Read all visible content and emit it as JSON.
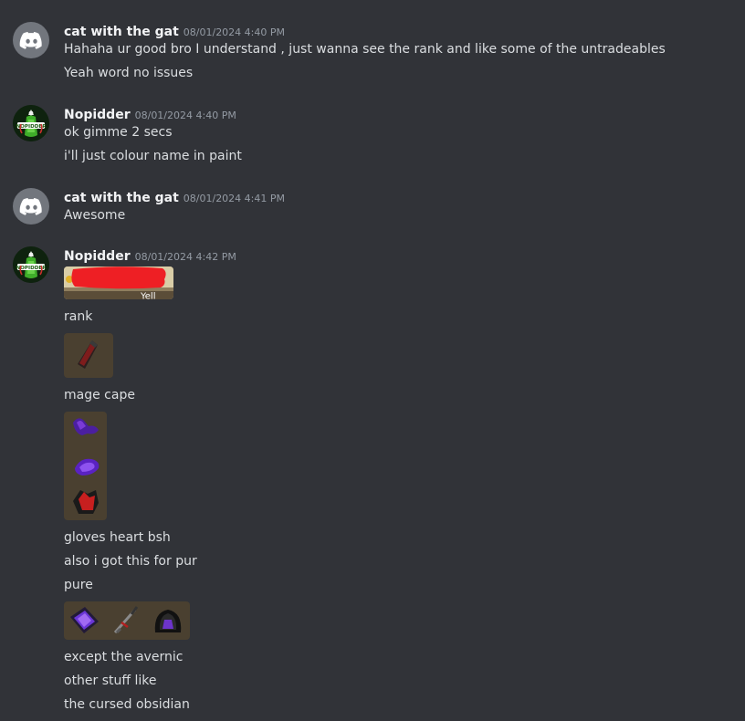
{
  "messages": [
    {
      "username": "cat with the gat",
      "timestamp": "08/01/2024 4:40 PM",
      "lines": [
        "Hahaha ur good bro I understand , just wanna see the rank and like some of the untradeables",
        "Yeah word no issues"
      ]
    },
    {
      "username": "Nopidder",
      "timestamp": "08/01/2024 4:40 PM",
      "avatar_text": "NOPIDDER",
      "lines": [
        "ok gimme 2 secs",
        "i'll just colour name in paint"
      ]
    },
    {
      "username": "cat with the gat",
      "timestamp": "08/01/2024 4:41 PM",
      "lines": [
        "Awesome"
      ]
    },
    {
      "username": "Nopidder",
      "timestamp": "08/01/2024 4:42 PM",
      "avatar_text": "NOPIDDER",
      "rank_image_text": "Yell",
      "lines": [
        "rank",
        "mage cape",
        "gloves heart bsh",
        "also i got this for pur",
        "pure",
        "except the avernic",
        "other stuff like",
        "the cursed obsidian"
      ]
    }
  ],
  "icons": {
    "discord_avatar": "discord-logo-icon",
    "nopidder_avatar": "nopidder-avatar"
  },
  "colors": {
    "background": "#313338",
    "username": "#f2f3f5",
    "timestamp": "#949ba4",
    "text": "#dbdee1",
    "discord_avatar_bg": "#72767d"
  }
}
